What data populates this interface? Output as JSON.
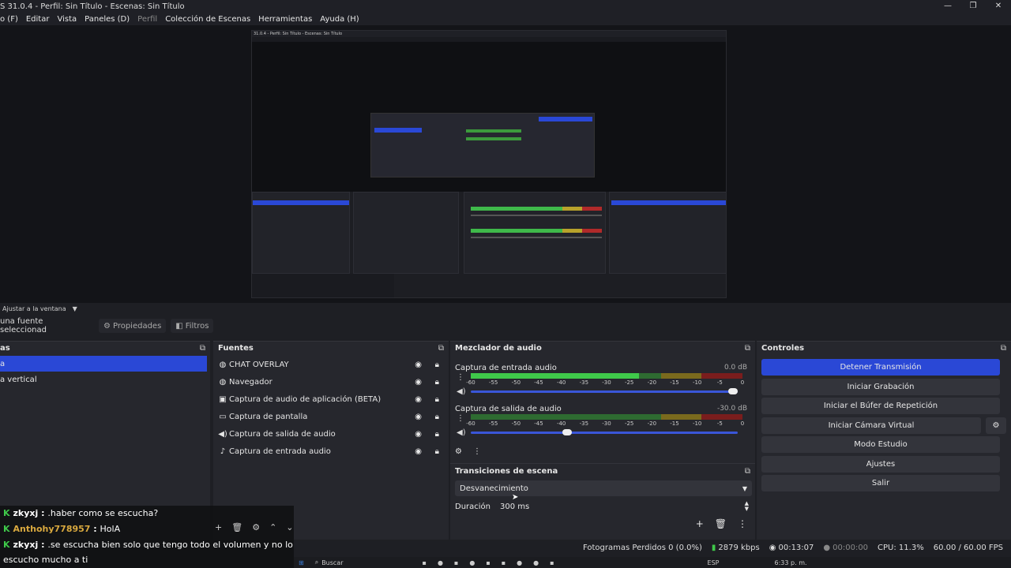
{
  "window": {
    "title": "S 31.0.4 - Perfil: Sin Título - Escenas: Sin Título",
    "controls": [
      "—",
      "❐",
      "✕"
    ]
  },
  "menu": [
    {
      "label": "o (F)",
      "dim": false
    },
    {
      "label": "Editar",
      "dim": false
    },
    {
      "label": "Vista",
      "dim": false
    },
    {
      "label": "Paneles (D)",
      "dim": false
    },
    {
      "label": "Perfil",
      "dim": true
    },
    {
      "label": "Colección de Escenas",
      "dim": false
    },
    {
      "label": "Herramientas",
      "dim": false
    },
    {
      "label": "Ayuda (H)",
      "dim": false
    }
  ],
  "preview": {
    "fit_label": "Ajustar a la ventana",
    "nested_title": "31.0.4 - Perfil: Sin Título - Escenas: Sin Título"
  },
  "props": {
    "no_source": "una fuente seleccionad",
    "properties": "Propiedades",
    "filters": "Filtros"
  },
  "scenes": {
    "header": "as",
    "items": [
      {
        "label": "a",
        "selected": true
      },
      {
        "label": "a vertical",
        "selected": false
      }
    ]
  },
  "sources": {
    "header": "Fuentes",
    "items": [
      {
        "label": "CHAT OVERLAY",
        "icon": "globe-icon"
      },
      {
        "label": "Navegador",
        "icon": "globe-icon"
      },
      {
        "label": "Captura de audio de aplicación (BETA)",
        "icon": "app-audio-icon"
      },
      {
        "label": "Captura de pantalla",
        "icon": "monitor-icon"
      },
      {
        "label": "Captura de salida de audio",
        "icon": "speaker-icon"
      },
      {
        "label": "Captura de entrada audio",
        "icon": "microphone-icon"
      }
    ]
  },
  "mixer": {
    "header": "Mezclador de audio",
    "ticks": [
      "-60",
      "-55",
      "-50",
      "-45",
      "-40",
      "-35",
      "-30",
      "-25",
      "-20",
      "-15",
      "-10",
      "-5",
      "0"
    ],
    "channels": [
      {
        "name": "Captura de entrada audio",
        "db": "0.0 dB",
        "level": 0.62,
        "volume": 1.0
      },
      {
        "name": "Captura de salida de audio",
        "db": "-30.0 dB",
        "level": 0.0,
        "volume": 0.38
      }
    ]
  },
  "transitions": {
    "header": "Transiciones de escena",
    "selected": "Desvanecimiento",
    "duration_label": "Duración",
    "duration_value": "300 ms"
  },
  "controls": {
    "header": "Controles",
    "buttons": [
      {
        "label": "Detener Transmisión",
        "active": true
      },
      {
        "label": "Iniciar Grabación",
        "active": false
      },
      {
        "label": "Iniciar el Búfer de Repetición",
        "active": false
      },
      {
        "label": "Iniciar Cámara Virtual",
        "active": false
      },
      {
        "label": "Modo Estudio",
        "active": false
      },
      {
        "label": "Ajustes",
        "active": false
      },
      {
        "label": "Salir",
        "active": false
      }
    ]
  },
  "status": {
    "dropped": "Fotogramas Perdidos 0 (0.0%)",
    "bitrate": "2879 kbps",
    "stream_time": "00:13:07",
    "rec_time": "00:00:00",
    "cpu": "CPU: 11.3%",
    "fps": "60.00 / 60.00 FPS"
  },
  "chat": [
    {
      "user": "zkyxj",
      "sep": " : ",
      "msg": ".haber como se escucha?",
      "alt": false
    },
    {
      "user": "Anthohy778957",
      "sep": " : ",
      "msg": "HolA",
      "alt": true
    },
    {
      "user": "zkyxj",
      "sep": " : ",
      "msg": ".se escucha bien solo que tengo todo el volumen y no lo",
      "alt": false
    },
    {
      "user": "",
      "sep": "",
      "msg": "escucho mucho a ti",
      "alt": false
    }
  ],
  "taskbar": {
    "search": "Buscar",
    "lang": "ESP",
    "clock": "6:33 p. m."
  }
}
